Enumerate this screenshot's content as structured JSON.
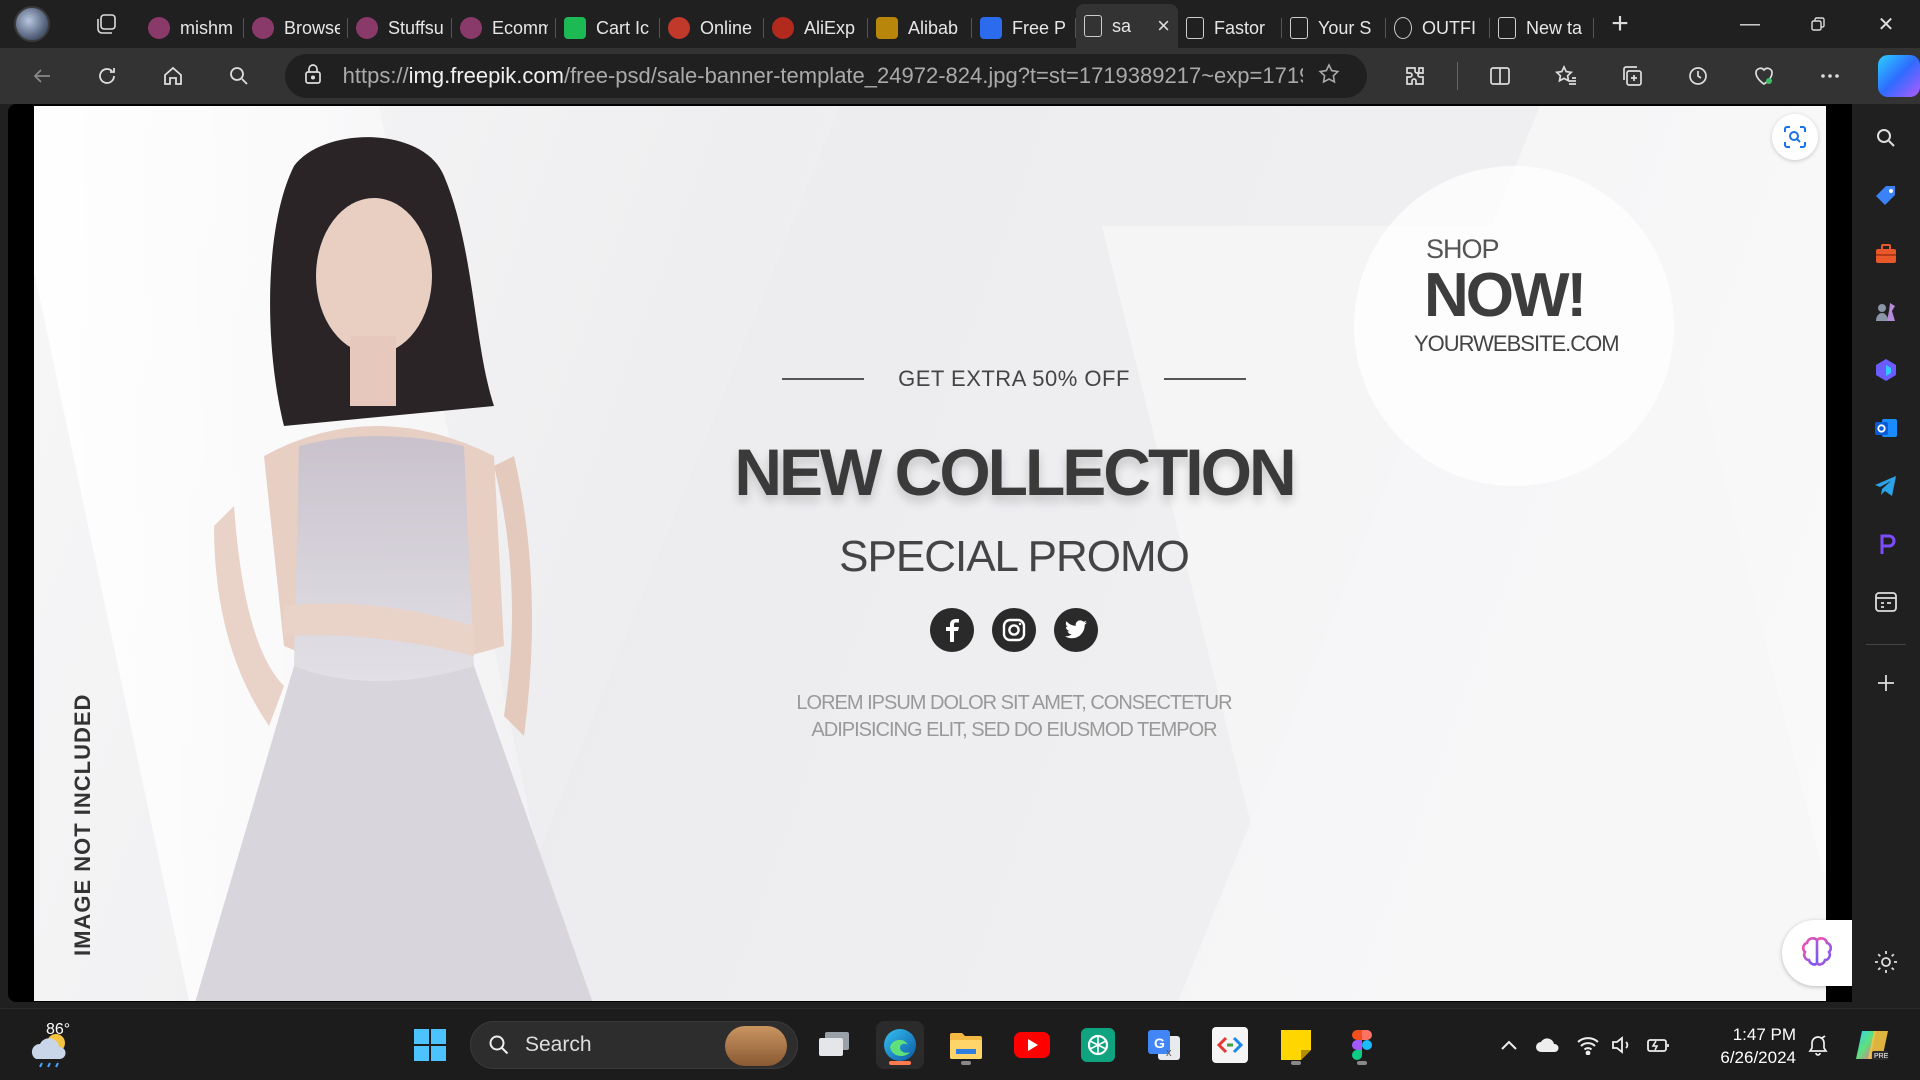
{
  "tabs": [
    {
      "title": "mishm",
      "favicon": "dribbble-icon",
      "color": "#8a3a6a"
    },
    {
      "title": "Browse",
      "favicon": "dribbble-icon",
      "color": "#8a3a6a"
    },
    {
      "title": "Stuffsu",
      "favicon": "dribbble-icon",
      "color": "#8a3a6a"
    },
    {
      "title": "Ecomm",
      "favicon": "dribbble-icon",
      "color": "#8a3a6a"
    },
    {
      "title": "Cart Ic",
      "favicon": "green-square-icon",
      "color": "#1db954"
    },
    {
      "title": "Online",
      "favicon": "fire-icon",
      "color": "#c0392b"
    },
    {
      "title": "AliExp",
      "favicon": "aliexpress-icon",
      "color": "#b2291e"
    },
    {
      "title": "Alibab",
      "favicon": "alibaba-icon",
      "color": "#b8860b"
    },
    {
      "title": "Free P",
      "favicon": "freepik-icon",
      "color": "#2c6bed"
    },
    {
      "title": "sa",
      "favicon": "page-icon",
      "color": "#333333",
      "active": true
    },
    {
      "title": "Fastor",
      "favicon": "page-icon",
      "color": "#202020"
    },
    {
      "title": "Your S",
      "favicon": "cart-icon",
      "color": "#202020"
    },
    {
      "title": "OUTFI",
      "favicon": "circle-icon",
      "color": "#202020"
    },
    {
      "title": "New ta",
      "favicon": "newtab-icon",
      "color": "#202020"
    }
  ],
  "address": {
    "scheme": "https://",
    "host": "img.freepik.com",
    "path": "/free-psd/sale-banner-template_24972-824.jpg?t=st=1719389217~exp=1719..."
  },
  "banner": {
    "side_note": "IMAGE NOT INCLUDED",
    "offer": "GET EXTRA 50% OFF",
    "headline": "NEW COLLECTION",
    "subheadline": "SPECIAL PROMO",
    "social": [
      "facebook-icon",
      "instagram-icon",
      "twitter-icon"
    ],
    "lorem_line1": "LOREM IPSUM DOLOR SIT AMET, CONSECTETUR",
    "lorem_line2": "ADIPISICING ELIT, SED DO EIUSMOD TEMPOR",
    "shop_small": "SHOP",
    "shop_big": "NOW!",
    "website": "YOURWEBSITE.COM"
  },
  "taskbar": {
    "temperature": "86°",
    "search_label": "Search",
    "time": "1:47 PM",
    "date": "6/26/2024"
  },
  "colors": {
    "browser_bg": "#202020",
    "toolbar_bg": "#333333",
    "accent_copilot": "#2e6bff",
    "youtube": "#ff0000"
  }
}
